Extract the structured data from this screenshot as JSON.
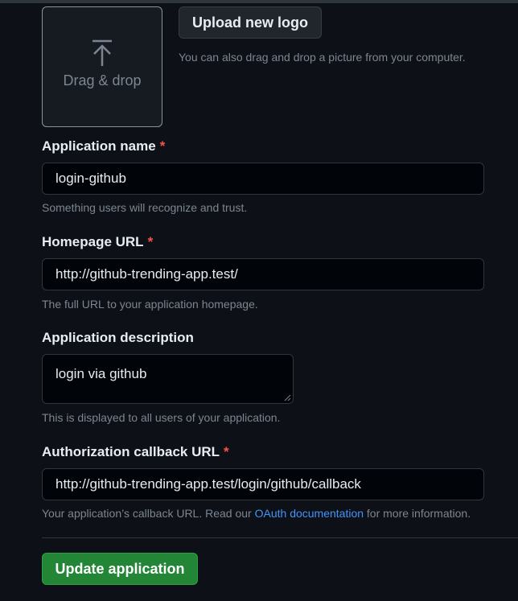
{
  "logo": {
    "dropzone_text": "Drag & drop",
    "upload_button": "Upload new logo",
    "upload_hint": "You can also drag and drop a picture from your computer.",
    "icon": "upload-arrow-icon"
  },
  "fields": {
    "app_name": {
      "label": "Application name",
      "required_mark": "*",
      "value": "login-github",
      "hint": "Something users will recognize and trust."
    },
    "homepage": {
      "label": "Homepage URL",
      "required_mark": "*",
      "value": "http://github-trending-app.test/",
      "hint": "The full URL to your application homepage."
    },
    "description": {
      "label": "Application description",
      "value": "login via github",
      "hint": "This is displayed to all users of your application."
    },
    "callback": {
      "label": "Authorization callback URL",
      "required_mark": "*",
      "value": "http://github-trending-app.test/login/github/callback",
      "hint_before": "Your application’s callback URL. Read our ",
      "hint_link": "OAuth documentation",
      "hint_after": " for more information."
    }
  },
  "actions": {
    "submit_label": "Update application"
  },
  "colors": {
    "background": "#0d1117",
    "required": "#f85149",
    "link": "#4493f8",
    "primary_button": "#238636"
  }
}
